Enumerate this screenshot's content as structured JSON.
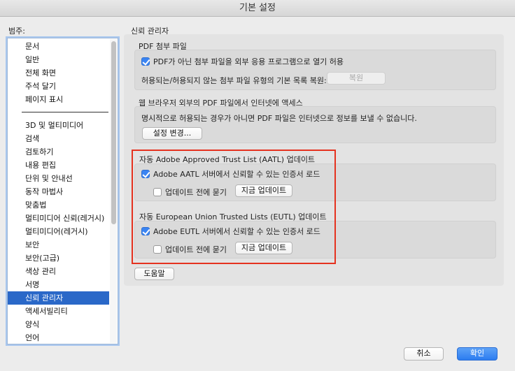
{
  "window": {
    "title": "기본 설정"
  },
  "categories": {
    "label": "범주:",
    "group1": [
      "문서",
      "일반",
      "전체 화면",
      "주석 달기",
      "페이지 표시"
    ],
    "group2": [
      "3D 및 멀티미디어",
      "검색",
      "검토하기",
      "내용 편집",
      "단위 및 안내선",
      "동작 마법사",
      "맞춤법",
      "멀티미디어 신뢰(레거시)",
      "멀티미디어(레거시)",
      "보안",
      "보안(고급)",
      "색상 관리",
      "서명",
      "신뢰 관리자",
      "액세서빌리티",
      "양식",
      "언어"
    ],
    "selected": "신뢰 관리자"
  },
  "main": {
    "title": "신뢰 관리자",
    "pdf_attach": {
      "label": "PDF 첨부 파일",
      "checkbox_label": "PDF가 아닌 첨부 파일을 외부 응용 프로그램으로 열기 허용",
      "checked": true,
      "restore_text": "허용되는/허용되지 않는 첨부 파일 유형의 기본 목록 복원:",
      "restore_button": "복원"
    },
    "internet": {
      "label": "웹 브라우저 외부의 PDF 파일에서 인터넷에 액세스",
      "text": "명시적으로 허용되는 경우가 아니면 PDF 파일은 인터넷으로 정보를 보낼 수 없습니다.",
      "button": "설정 변경..."
    },
    "aatl": {
      "label": "자동 Adobe Approved Trust List (AATL) 업데이트",
      "load_label": "Adobe AATL 서버에서 신뢰할 수 있는 인증서 로드",
      "load_checked": true,
      "ask_label": "업데이트 전에 묻기",
      "ask_checked": false,
      "update_button": "지금 업데이트"
    },
    "eutl": {
      "label": "자동 European Union Trusted Lists (EUTL) 업데이트",
      "load_label": "Adobe EUTL 서버에서 신뢰할 수 있는 인증서 로드",
      "load_checked": true,
      "ask_label": "업데이트 전에 묻기",
      "ask_checked": false,
      "update_button": "지금 업데이트"
    },
    "help_button": "도움말"
  },
  "footer": {
    "cancel": "취소",
    "ok": "확인"
  },
  "colors": {
    "selection": "#2a68c8",
    "highlight_border": "#e5321f",
    "primary_button": "#2c7cf0"
  }
}
